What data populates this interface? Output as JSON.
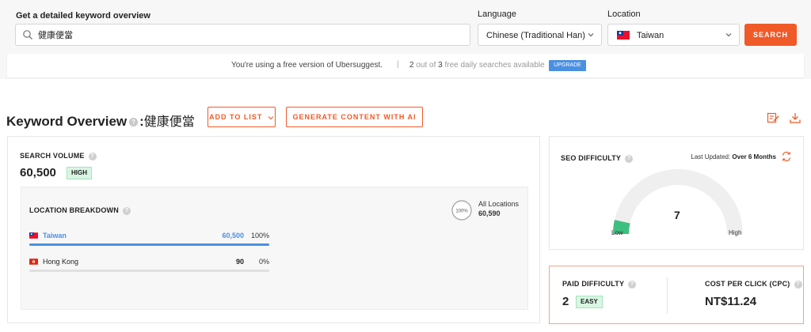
{
  "search": {
    "label": "Get a detailed keyword overview",
    "value": "健康便當",
    "placeholder": ""
  },
  "language": {
    "label": "Language",
    "value": "Chinese (Traditional Han)"
  },
  "location": {
    "label": "Location",
    "value": "Taiwan"
  },
  "search_button": "SEARCH",
  "notice": {
    "message": "You're using a free version of Ubersuggest.",
    "separator": "|",
    "used": "2",
    "quota_mid": " out of ",
    "limit": "3",
    "quota_end": " free daily searches available",
    "upgrade": "UPGRADE"
  },
  "overview": {
    "title": "Keyword Overview",
    "help": "?",
    "colon": ":",
    "keyword": "健康便當",
    "add_to_list": "ADD TO LIST",
    "generate": "GENERATE CONTENT WITH AI"
  },
  "search_volume": {
    "label": "SEARCH VOLUME",
    "help": "?",
    "value": "60,500",
    "badge": "HIGH"
  },
  "location_breakdown": {
    "label": "LOCATION BREAKDOWN",
    "help": "?",
    "ring_label": "100%",
    "all_label": "All Locations",
    "all_value": "60,590",
    "rows": [
      {
        "name": "Taiwan",
        "volume": "60,500",
        "percent": "100%",
        "share": 1.0
      },
      {
        "name": "Hong Kong",
        "volume": "90",
        "percent": "0%",
        "share": 0.0
      }
    ]
  },
  "seo_difficulty": {
    "label": "SEO DIFFICULTY",
    "help": "?",
    "last_updated_label": "Last Updated:",
    "last_updated_value": "Over 6 Months",
    "value": "7",
    "score": 7,
    "low": "Low",
    "high": "High"
  },
  "paid_difficulty": {
    "label": "PAID DIFFICULTY",
    "help": "?",
    "value": "2",
    "badge": "EASY"
  },
  "cpc": {
    "label": "COST PER CLICK (CPC)",
    "help": "?",
    "value": "NT$11.24"
  },
  "colors": {
    "accent": "#f05a28",
    "link_blue": "#4a90e2",
    "easy_green": "#3fbf7f",
    "gauge_track": "#efefef"
  },
  "icons": {
    "search": "magnifier-icon",
    "chevron": "chevron-down-icon",
    "export": "edit-note-icon",
    "download": "download-icon",
    "refresh": "refresh-icon"
  }
}
